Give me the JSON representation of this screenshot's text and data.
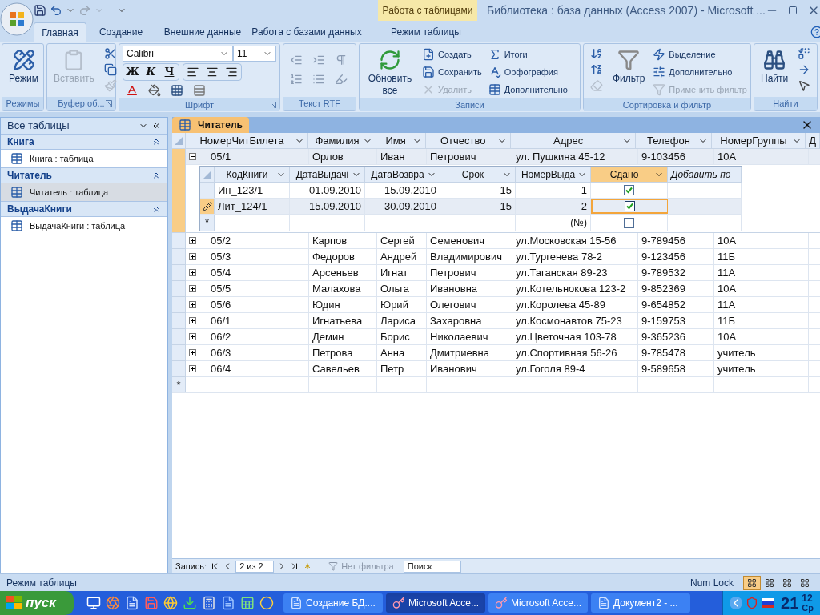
{
  "window": {
    "title": "Библиотека : база данных (Access 2007) - Microsoft ...",
    "context_tab": "Работа с таблицами"
  },
  "ribbon_tabs": [
    {
      "label": "Главная",
      "selected": true
    },
    {
      "label": "Создание",
      "selected": false
    },
    {
      "label": "Внешние данные",
      "selected": false
    },
    {
      "label": "Работа с базами данных",
      "selected": false
    },
    {
      "label": "Режим таблицы",
      "selected": false
    }
  ],
  "ribbon_groups": [
    {
      "kind": "modes",
      "title": "Режимы",
      "large": [
        {
          "label": "Режим",
          "disabled": false
        }
      ]
    },
    {
      "kind": "clipboard",
      "title": "Буфер об...",
      "large": [
        {
          "label": "Вставить",
          "disabled": true
        }
      ]
    },
    {
      "kind": "font",
      "title": "Шрифт",
      "font": "Calibri",
      "size": "11",
      "styles": [
        "Ж",
        "К",
        "Ч"
      ]
    },
    {
      "kind": "rtf",
      "title": "Текст RTF"
    },
    {
      "kind": "records",
      "title": "Записи",
      "large": [
        {
          "label": "Обновить все",
          "disabled": false
        }
      ],
      "small": [
        {
          "label": "Создать",
          "disabled": false
        },
        {
          "label": "Сохранить",
          "disabled": false
        },
        {
          "label": "Удалить",
          "disabled": true
        },
        {
          "label": "Итоги",
          "disabled": false
        },
        {
          "label": "Орфография",
          "disabled": false
        },
        {
          "label": "Дополнительно",
          "disabled": false
        }
      ]
    },
    {
      "kind": "sort",
      "title": "Сортировка и фильтр",
      "large": [
        {
          "label": "Фильтр",
          "disabled": false
        }
      ],
      "small": [
        {
          "label": "Выделение",
          "disabled": false
        },
        {
          "label": "Дополнительно",
          "disabled": false
        },
        {
          "label": "Применить фильтр",
          "disabled": true
        }
      ]
    },
    {
      "kind": "find",
      "title": "Найти",
      "large": [
        {
          "label": "Найти",
          "disabled": false
        }
      ]
    }
  ],
  "nav": {
    "header": "Все таблицы",
    "groups": [
      {
        "title": "Книга",
        "items": [
          {
            "label": "Книга : таблица",
            "selected": false
          }
        ]
      },
      {
        "title": "Читатель",
        "items": [
          {
            "label": "Читатель : таблица",
            "selected": true
          }
        ]
      },
      {
        "title": "ВыдачаКниги",
        "items": [
          {
            "label": "ВыдачаКниги : таблица",
            "selected": false
          }
        ]
      }
    ]
  },
  "document_tab": "Читатель",
  "table": {
    "columns": [
      {
        "label": "НомерЧитБилета",
        "kind": "field"
      },
      {
        "label": "Фамилия",
        "kind": "field"
      },
      {
        "label": "Имя",
        "kind": "field"
      },
      {
        "label": "Отчество",
        "kind": "field"
      },
      {
        "label": "Адрес",
        "kind": "field"
      },
      {
        "label": "Телефон",
        "kind": "field"
      },
      {
        "label": "НомерГруппы",
        "kind": "field"
      },
      {
        "label": "Д",
        "kind": "cut"
      }
    ],
    "rows": [
      {
        "cells": [
          "05/1",
          "Орлов",
          "Иван",
          "Петрович",
          "ул. Пушкина 45-12",
          "9-103456",
          "10А"
        ],
        "expanded": true,
        "current": true,
        "subtable": {
          "columns": [
            {
              "label": "КодКниги",
              "kind": "field",
              "selected": false
            },
            {
              "label": "ДатаВыдачі",
              "kind": "field",
              "selected": false
            },
            {
              "label": "ДатаВозвра",
              "kind": "field",
              "selected": false
            },
            {
              "label": "Срок",
              "kind": "field",
              "selected": false
            },
            {
              "label": "НомерВыда",
              "kind": "field",
              "selected": false
            },
            {
              "label": "Сдано",
              "kind": "field",
              "selected": true
            },
            {
              "label": "Добавить по",
              "kind": "add",
              "selected": false
            }
          ],
          "rows": [
            {
              "cells": [
                "Ин_123/1",
                "01.09.2010",
                "15.09.2010",
                "15",
                "1"
              ],
              "done": true,
              "editing": false
            },
            {
              "cells": [
                "Лит_124/1",
                "15.09.2010",
                "30.09.2010",
                "15",
                "2"
              ],
              "done": true,
              "editing": true
            }
          ],
          "new_row": {
            "marker": "*",
            "number": "(№)",
            "done": false
          }
        }
      },
      {
        "cells": [
          "05/2",
          "Карпов",
          "Сергей",
          "Семенович",
          "ул.Московская 15-56",
          "9-789456",
          "10А"
        ],
        "expanded": false,
        "current": false
      },
      {
        "cells": [
          "05/3",
          "Федоров",
          "Андрей",
          "Владимирович",
          "ул.Тургенева 78-2",
          "9-123456",
          "11Б"
        ],
        "expanded": false,
        "current": false
      },
      {
        "cells": [
          "05/4",
          "Арсеньев",
          "Игнат",
          "Петрович",
          "ул.Таганская 89-23",
          "9-789532",
          "11А"
        ],
        "expanded": false,
        "current": false
      },
      {
        "cells": [
          "05/5",
          "Малахова",
          "Ольга",
          "Ивановна",
          "ул.Котельнокова 123-2",
          "9-852369",
          "10А"
        ],
        "expanded": false,
        "current": false
      },
      {
        "cells": [
          "05/6",
          "Юдин",
          "Юрий",
          "Олегович",
          "ул.Королева 45-89",
          "9-654852",
          "11А"
        ],
        "expanded": false,
        "current": false
      },
      {
        "cells": [
          "06/1",
          "Игнатьева",
          "Лариса",
          "Захаровна",
          "ул.Космонавтов 75-23",
          "9-159753",
          "11Б"
        ],
        "expanded": false,
        "current": false
      },
      {
        "cells": [
          "06/2",
          "Демин",
          "Борис",
          "Николаевич",
          "ул.Цветочная 103-78",
          "9-365236",
          "10А"
        ],
        "expanded": false,
        "current": false
      },
      {
        "cells": [
          "06/3",
          "Петрова",
          "Анна",
          "Дмитриевна",
          "ул.Спортивная 56-26",
          "9-785478",
          "учитель"
        ],
        "expanded": false,
        "current": false
      },
      {
        "cells": [
          "06/4",
          "Савельев",
          "Петр",
          "Иванович",
          "ул.Гоголя 89-4",
          "9-589658",
          "учитель"
        ],
        "expanded": false,
        "current": false
      }
    ],
    "new_row_marker": "*"
  },
  "record_nav": {
    "label": "Запись:",
    "position": "2 из 2",
    "filter": "Нет фильтра",
    "search_placeholder": "Поиск"
  },
  "status_bar": {
    "mode": "Режим таблицы",
    "indicator": "Num Lock",
    "views": [
      {
        "selected": true
      },
      {
        "selected": false
      },
      {
        "selected": false
      },
      {
        "selected": false
      }
    ]
  },
  "taskbar": {
    "start": "пуск",
    "tasks": [
      {
        "label": "Создание БД....",
        "kind": "word",
        "selected": false
      },
      {
        "label": "Microsoft Acce...",
        "kind": "access",
        "selected": true
      },
      {
        "label": "Microsoft Acce...",
        "kind": "access",
        "selected": false
      },
      {
        "label": "Документ2 - ...",
        "kind": "word",
        "selected": false
      }
    ],
    "clock": {
      "hour": "21",
      "minute": "12",
      "weekday": "Ср"
    }
  }
}
